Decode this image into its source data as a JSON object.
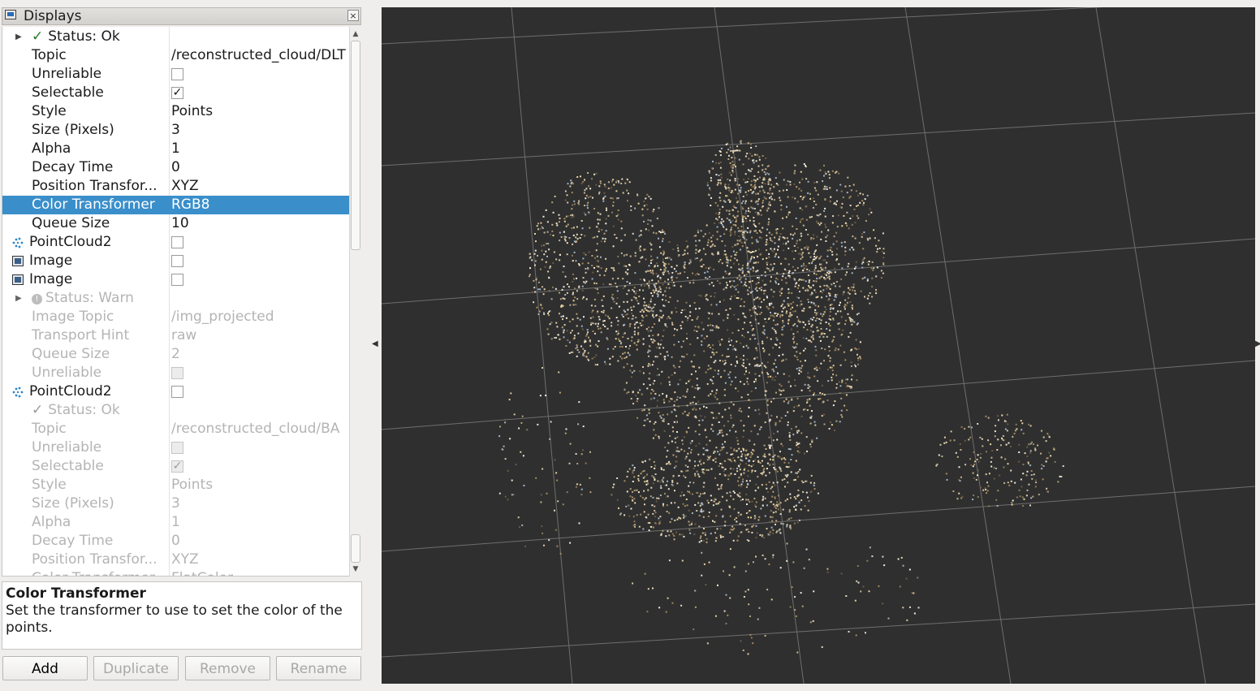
{
  "panel": {
    "title": "Displays",
    "close_glyph": "×"
  },
  "tree": {
    "rows": [
      {
        "kind": "status",
        "name": "Status: Ok",
        "glyph": "✓",
        "indent": 38,
        "expand": "▶",
        "state": "normal"
      },
      {
        "kind": "prop",
        "name": "Topic",
        "value": "/reconstructed_cloud/DLT",
        "state": "normal"
      },
      {
        "kind": "check",
        "name": "Unreliable",
        "checked": false,
        "state": "normal"
      },
      {
        "kind": "check",
        "name": "Selectable",
        "checked": true,
        "state": "normal"
      },
      {
        "kind": "prop",
        "name": "Style",
        "value": "Points",
        "state": "normal"
      },
      {
        "kind": "prop",
        "name": "Size (Pixels)",
        "value": "3",
        "state": "normal"
      },
      {
        "kind": "prop",
        "name": "Alpha",
        "value": "1",
        "state": "normal"
      },
      {
        "kind": "prop",
        "name": "Decay Time",
        "value": "0",
        "state": "normal"
      },
      {
        "kind": "prop",
        "name": "Position Transfor...",
        "value": "XYZ",
        "state": "normal"
      },
      {
        "kind": "prop",
        "name": "Color Transformer",
        "value": "RGB8",
        "state": "selected"
      },
      {
        "kind": "prop",
        "name": "Queue Size",
        "value": "10",
        "state": "normal"
      },
      {
        "kind": "display",
        "icon": "pointcloud-icon",
        "name": "PointCloud2",
        "checked": false,
        "state": "normal"
      },
      {
        "kind": "display",
        "icon": "image-icon",
        "name": "Image",
        "checked": false,
        "state": "normal"
      },
      {
        "kind": "display",
        "icon": "image-icon",
        "name": "Image",
        "checked": false,
        "state": "normal"
      },
      {
        "kind": "warn",
        "name": "Status: Warn",
        "glyph": "!",
        "expand": "▶",
        "state": "dim"
      },
      {
        "kind": "prop",
        "name": "Image Topic",
        "value": "/img_projected",
        "state": "dim"
      },
      {
        "kind": "prop",
        "name": "Transport Hint",
        "value": "raw",
        "state": "dim"
      },
      {
        "kind": "prop",
        "name": "Queue Size",
        "value": "2",
        "state": "dim"
      },
      {
        "kind": "check",
        "name": "Unreliable",
        "checked": false,
        "state": "dim"
      },
      {
        "kind": "display",
        "icon": "pointcloud-icon",
        "name": "PointCloud2",
        "checked": false,
        "state": "normal"
      },
      {
        "kind": "status",
        "name": "Status: Ok",
        "glyph": "✓",
        "state": "dim"
      },
      {
        "kind": "prop",
        "name": "Topic",
        "value": "/reconstructed_cloud/BA",
        "state": "dim"
      },
      {
        "kind": "check",
        "name": "Unreliable",
        "checked": false,
        "state": "dim"
      },
      {
        "kind": "check",
        "name": "Selectable",
        "checked": true,
        "state": "dim"
      },
      {
        "kind": "prop",
        "name": "Style",
        "value": "Points",
        "state": "dim"
      },
      {
        "kind": "prop",
        "name": "Size (Pixels)",
        "value": "3",
        "state": "dim"
      },
      {
        "kind": "prop",
        "name": "Alpha",
        "value": "1",
        "state": "dim"
      },
      {
        "kind": "prop",
        "name": "Decay Time",
        "value": "0",
        "state": "dim"
      },
      {
        "kind": "prop",
        "name": "Position Transfor...",
        "value": "XYZ",
        "state": "dim"
      },
      {
        "kind": "prop",
        "name": "Color Transformer",
        "value": "FlatColor",
        "state": "dim"
      }
    ]
  },
  "help": {
    "title": "Color Transformer",
    "text": "Set the transformer to use to set the color of the points."
  },
  "buttons": {
    "add": "Add",
    "duplicate": "Duplicate",
    "remove": "Remove",
    "rename": "Rename"
  },
  "splitter": {
    "left_arrow": "◀",
    "right_arrow": "▶"
  },
  "colors": {
    "selection": "#3a8fcb",
    "viewport_bg": "#2f2f2f",
    "grid_line": "#6e6e6e",
    "status_ok": "#2a7a2a"
  },
  "icons": {
    "display_panel": "displays-icon",
    "pointcloud": "pointcloud-icon",
    "image": "image-icon",
    "warning": "warning-icon"
  }
}
